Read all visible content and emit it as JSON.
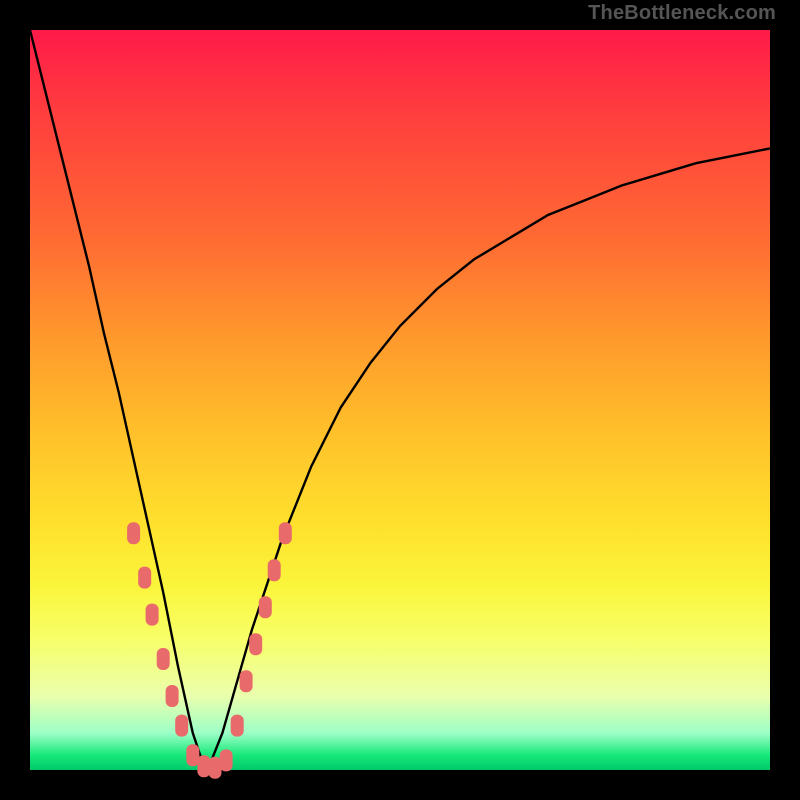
{
  "watermark": "TheBottleneck.com",
  "chart_data": {
    "type": "line",
    "title": "",
    "xlabel": "",
    "ylabel": "",
    "xlim": [
      0,
      100
    ],
    "ylim": [
      0,
      100
    ],
    "grid": false,
    "curve_left": {
      "name": "bottleneck-left",
      "color": "#000000",
      "x": [
        0,
        2,
        4,
        6,
        8,
        10,
        12,
        14,
        16,
        18,
        20,
        22,
        23,
        24
      ],
      "y": [
        100,
        92,
        84,
        76,
        68,
        59,
        51,
        42,
        33,
        24,
        14,
        5,
        2,
        0
      ]
    },
    "curve_right": {
      "name": "bottleneck-right",
      "color": "#000000",
      "x": [
        24,
        26,
        28,
        30,
        34,
        38,
        42,
        46,
        50,
        55,
        60,
        65,
        70,
        75,
        80,
        85,
        90,
        95,
        100
      ],
      "y": [
        0,
        5,
        12,
        19,
        31,
        41,
        49,
        55,
        60,
        65,
        69,
        72,
        75,
        77,
        79,
        80.5,
        82,
        83,
        84
      ]
    },
    "markers": {
      "name": "sample-points",
      "color": "#e96a6a",
      "shape": "rounded-rect",
      "points": [
        {
          "x": 14.0,
          "y": 32.0
        },
        {
          "x": 15.5,
          "y": 26.0
        },
        {
          "x": 16.5,
          "y": 21.0
        },
        {
          "x": 18.0,
          "y": 15.0
        },
        {
          "x": 19.2,
          "y": 10.0
        },
        {
          "x": 20.5,
          "y": 6.0
        },
        {
          "x": 22.0,
          "y": 2.0
        },
        {
          "x": 23.5,
          "y": 0.5
        },
        {
          "x": 25.0,
          "y": 0.3
        },
        {
          "x": 26.5,
          "y": 1.3
        },
        {
          "x": 28.0,
          "y": 6.0
        },
        {
          "x": 29.2,
          "y": 12.0
        },
        {
          "x": 30.5,
          "y": 17.0
        },
        {
          "x": 31.8,
          "y": 22.0
        },
        {
          "x": 33.0,
          "y": 27.0
        },
        {
          "x": 34.5,
          "y": 32.0
        }
      ]
    }
  }
}
